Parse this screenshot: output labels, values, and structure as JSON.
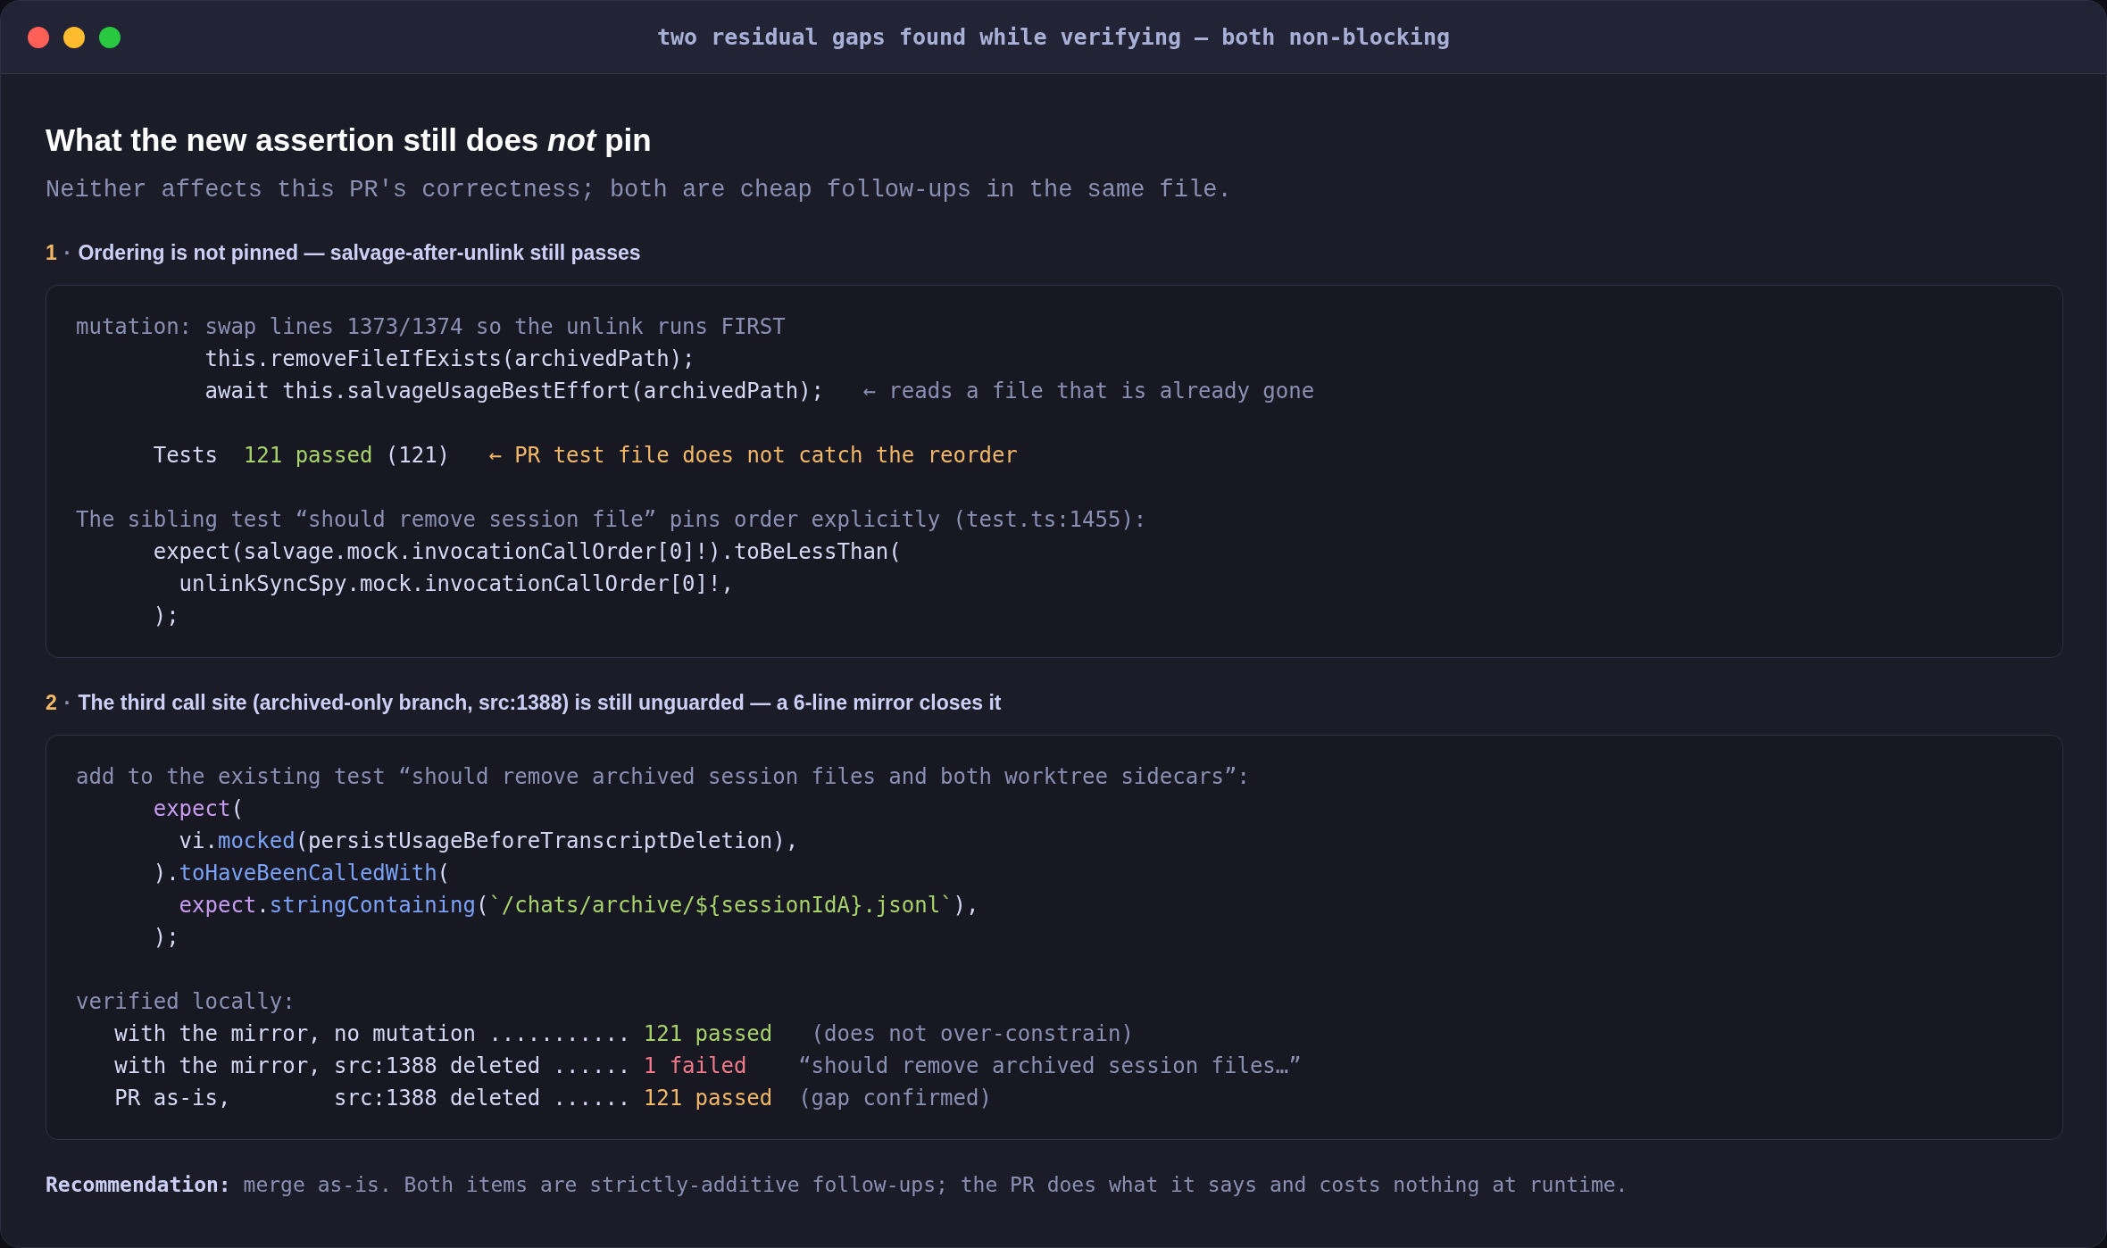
{
  "window": {
    "title": "two residual gaps found while verifying — both non-blocking"
  },
  "heading": "What the new assertion still does *not* pin",
  "subtitle": "Neither affects this PR's correctness; both are cheap follow-ups in the same file.",
  "sections": [
    {
      "number": "1",
      "separator": "·",
      "title": "Ordering is not pinned — salvage-after-unlink still passes",
      "code": [
        {
          "kind": "code",
          "segments": [
            {
              "kind": "comment",
              "text": "mutation: swap lines 1373/1374 so the unlink runs FIRST"
            }
          ]
        },
        {
          "kind": "code",
          "segments": [
            {
              "kind": "plain",
              "text": "          this.removeFileIfExists(archivedPath);"
            }
          ]
        },
        {
          "kind": "code",
          "segments": [
            {
              "kind": "plain",
              "text": "          await this.salvageUsageBestEffort(archivedPath);"
            },
            {
              "kind": "comment",
              "text": "   ← reads a file that is already gone"
            }
          ]
        },
        {
          "kind": "blank"
        },
        {
          "kind": "code",
          "segments": [
            {
              "kind": "plain",
              "text": "      Tests  "
            },
            {
              "kind": "pass",
              "text": "121 passed"
            },
            {
              "kind": "plain",
              "text": " (121)"
            },
            {
              "kind": "warn",
              "text": "   ← PR test file does not catch the reorder"
            }
          ]
        },
        {
          "kind": "blank"
        },
        {
          "kind": "code",
          "segments": [
            {
              "kind": "comment",
              "text": "The sibling test “should remove session file” pins order explicitly (test.ts:1455):"
            }
          ]
        },
        {
          "kind": "code",
          "segments": [
            {
              "kind": "plain",
              "text": "      expect(salvage.mock.invocationCallOrder[0]!).toBeLessThan("
            }
          ]
        },
        {
          "kind": "code",
          "segments": [
            {
              "kind": "plain",
              "text": "        unlinkSyncSpy.mock.invocationCallOrder[0]!,"
            }
          ]
        },
        {
          "kind": "code",
          "segments": [
            {
              "kind": "plain",
              "text": "      );"
            }
          ]
        }
      ]
    },
    {
      "number": "2",
      "separator": "·",
      "title": "The third call site (archived-only branch, src:1388) is still unguarded — a 6-line mirror closes it",
      "code": [
        {
          "kind": "code",
          "segments": [
            {
              "kind": "comment",
              "text": "add to the existing test “should remove archived session files and both worktree sidecars”:"
            }
          ]
        },
        {
          "kind": "code",
          "segments": [
            {
              "kind": "keyword",
              "text": "      expect"
            },
            {
              "kind": "plain",
              "text": "("
            }
          ]
        },
        {
          "kind": "code",
          "segments": [
            {
              "kind": "plain",
              "text": "        vi."
            },
            {
              "kind": "func",
              "text": "mocked"
            },
            {
              "kind": "plain",
              "text": "(persistUsageBeforeTranscriptDeletion),"
            }
          ]
        },
        {
          "kind": "code",
          "segments": [
            {
              "kind": "plain",
              "text": "      )."
            },
            {
              "kind": "func",
              "text": "toHaveBeenCalledWith"
            },
            {
              "kind": "plain",
              "text": "("
            }
          ]
        },
        {
          "kind": "code",
          "segments": [
            {
              "kind": "keyword",
              "text": "        expect"
            },
            {
              "kind": "plain",
              "text": "."
            },
            {
              "kind": "func",
              "text": "stringContaining"
            },
            {
              "kind": "plain",
              "text": "("
            },
            {
              "kind": "string",
              "text": "`/chats/archive/${sessionIdA}.jsonl`"
            },
            {
              "kind": "plain",
              "text": "),"
            }
          ]
        },
        {
          "kind": "code",
          "segments": [
            {
              "kind": "plain",
              "text": "      );"
            }
          ]
        },
        {
          "kind": "blank"
        },
        {
          "kind": "code",
          "segments": [
            {
              "kind": "comment",
              "text": "verified locally:"
            }
          ]
        },
        {
          "kind": "code",
          "segments": [
            {
              "kind": "plain",
              "text": "   with the mirror, no mutation ........... "
            },
            {
              "kind": "pass",
              "text": "121 passed"
            },
            {
              "kind": "comment",
              "text": "   (does not over-constrain)"
            }
          ]
        },
        {
          "kind": "code",
          "segments": [
            {
              "kind": "plain",
              "text": "   with the mirror, src:1388 deleted ...... "
            },
            {
              "kind": "fail",
              "text": "1 failed"
            },
            {
              "kind": "comment",
              "text": "    “should remove archived session files…”"
            }
          ]
        },
        {
          "kind": "code",
          "segments": [
            {
              "kind": "plain",
              "text": "   PR as-is,        src:1388 deleted ...... "
            },
            {
              "kind": "warn",
              "text": "121 passed"
            },
            {
              "kind": "comment",
              "text": "  (gap confirmed)"
            }
          ]
        }
      ]
    }
  ],
  "recommendation": {
    "label": "Recommendation:",
    "text": "merge as-is. Both items are strictly-additive follow-ups; the PR does what it says and costs nothing at runtime."
  }
}
